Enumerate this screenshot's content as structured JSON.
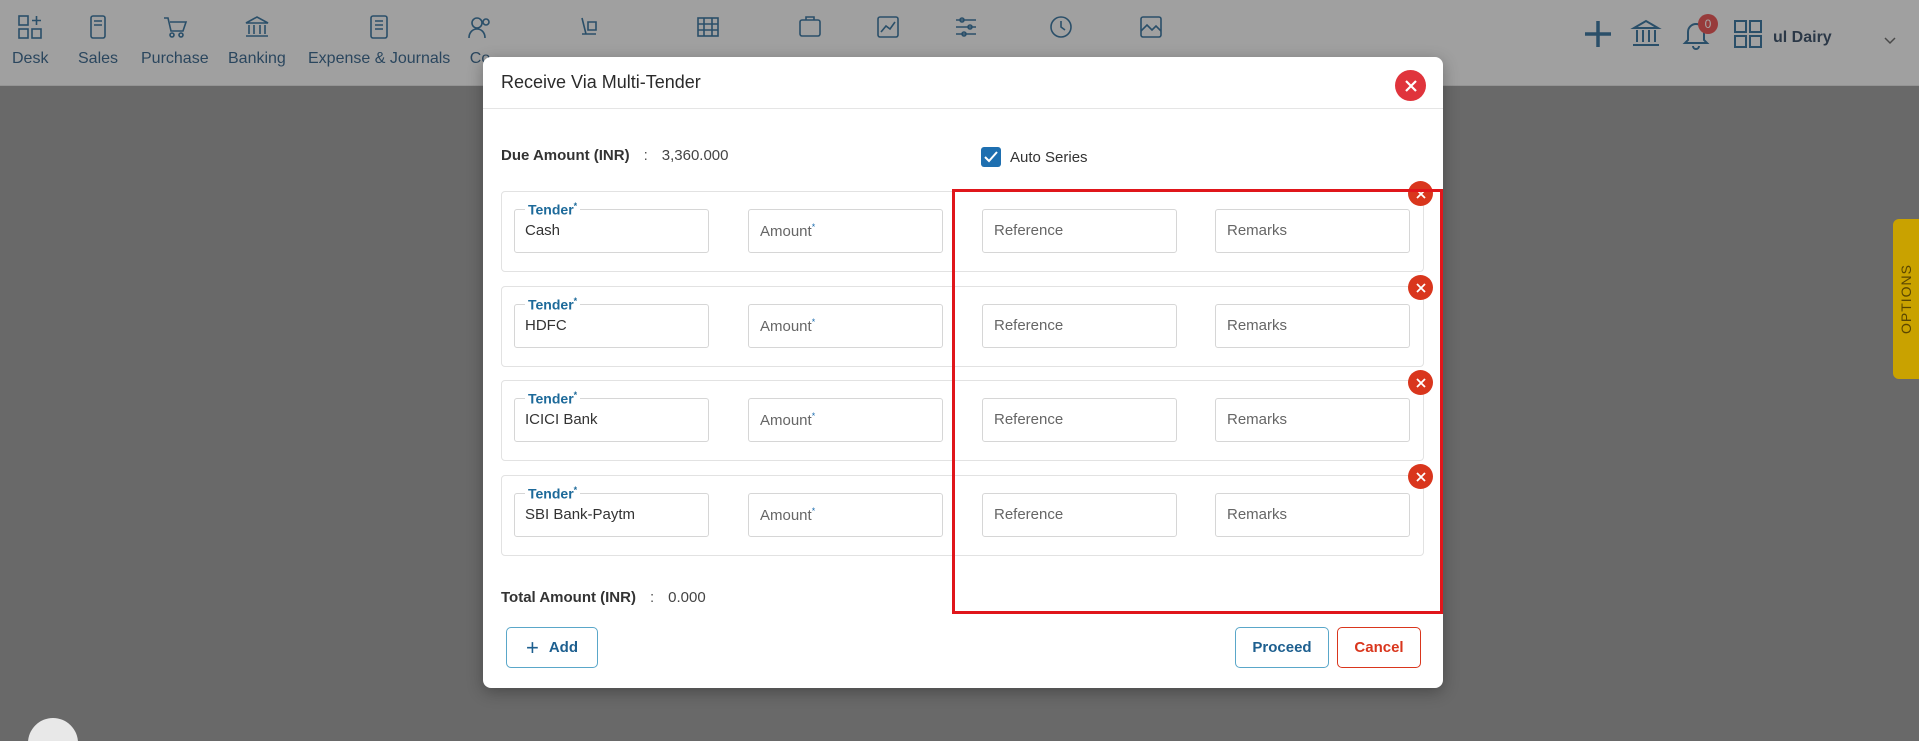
{
  "navbar": {
    "items": [
      {
        "label": "Desk",
        "icon": "desk-icon"
      },
      {
        "label": "Sales",
        "icon": "sales-icon"
      },
      {
        "label": "Purchase",
        "icon": "purchase-cart-icon"
      },
      {
        "label": "Banking",
        "icon": "bank-icon"
      },
      {
        "label": "Expense & Journals",
        "icon": "journal-icon"
      },
      {
        "label": "Co",
        "icon": "contacts-icon"
      }
    ],
    "notification_count": "0",
    "company": "ul Dairy"
  },
  "options_tab": "OPTIONS",
  "modal": {
    "title": "Receive Via Multi-Tender",
    "due_label": "Due Amount (INR)",
    "due_value": "3,360.000",
    "auto_series_label": "Auto Series",
    "auto_series_checked": true,
    "tender_label": "Tender",
    "amount_placeholder": "Amount",
    "reference_placeholder": "Reference",
    "remarks_placeholder": "Remarks",
    "required_mark": "*",
    "rows": [
      {
        "tender": "Cash"
      },
      {
        "tender": "HDFC"
      },
      {
        "tender": "ICICI Bank"
      },
      {
        "tender": "SBI Bank-Paytm"
      }
    ],
    "total_label": "Total Amount (INR)",
    "total_value": "0.000",
    "colon": ":",
    "add_label": "Add",
    "proceed_label": "Proceed",
    "cancel_label": "Cancel"
  },
  "colors": {
    "accent": "#1d5f8f",
    "danger": "#d9361d",
    "highlight": "#e0161b"
  }
}
